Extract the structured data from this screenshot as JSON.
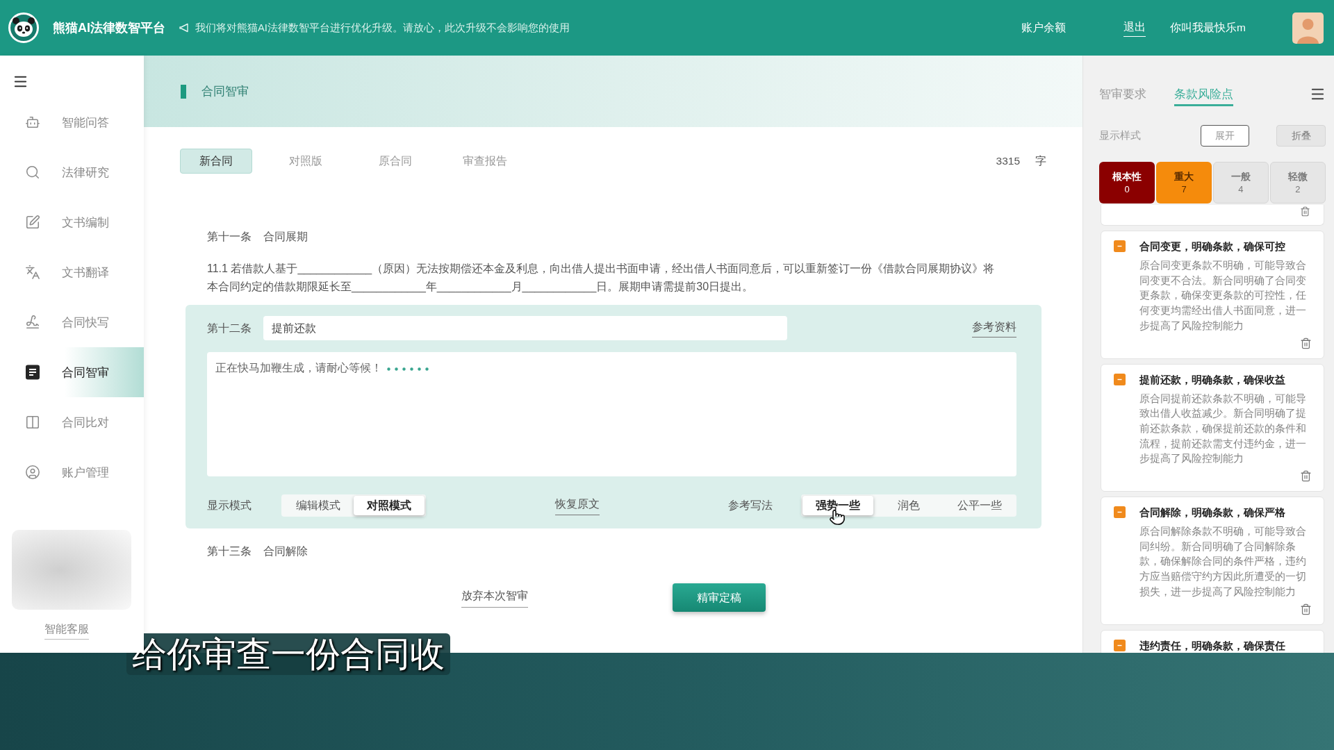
{
  "top_bar": {
    "title": "熊猫AI法律数智平台",
    "notice": "我们将对熊猫AI法律数智平台进行优化升级。请放心，此次升级不会影响您的使用",
    "balance_link": "账户余额",
    "logout_link": "退出",
    "user_name": "你叫我最快乐m"
  },
  "sidebar": {
    "items": [
      {
        "label": "智能问答",
        "selected": false
      },
      {
        "label": "法律研究",
        "selected": false
      },
      {
        "label": "文书编制",
        "selected": false
      },
      {
        "label": "文书翻译",
        "selected": false
      },
      {
        "label": "合同快写",
        "selected": false
      },
      {
        "label": "合同智审",
        "selected": true
      },
      {
        "label": "合同比对",
        "selected": false
      },
      {
        "label": "账户管理",
        "selected": false
      }
    ],
    "support_link": "智能客服"
  },
  "page_header": {
    "title": "合同智审"
  },
  "doc_tabs": [
    {
      "label": "新合同",
      "selected": true
    },
    {
      "label": "对照版",
      "selected": false
    },
    {
      "label": "原合同",
      "selected": false
    },
    {
      "label": "审查报告",
      "selected": false
    }
  ],
  "word_count": {
    "value": "3315",
    "unit": "字"
  },
  "document": [
    {
      "kind": "heading",
      "number": "第十一条",
      "title": "合同展期"
    },
    {
      "kind": "paragraph",
      "text": "11.1 若借款人基于____________（原因）无法按期偿还本金及利息，向出借人提出书面申请，经出借人书面同意后，可以重新签订一份《借款合同展期协议》将本合同约定的借款期限延长至____________年____________月____________日。展期申请需提前30日提出。"
    },
    {
      "kind": "editor",
      "number": "第十二条",
      "title_value": "提前还款",
      "reference_link": "参考资料",
      "status_text": "正在快马加鞭生成，请耐心等候！",
      "mode_label": "显示模式",
      "modes": [
        {
          "label": "编辑模式",
          "selected": false
        },
        {
          "label": "对照模式",
          "selected": true
        }
      ],
      "restore_link": "恢复原文",
      "style_label": "参考写法",
      "styles": [
        {
          "label": "强势一些",
          "selected": true
        },
        {
          "label": "润色",
          "selected": false
        },
        {
          "label": "公平一些",
          "selected": false
        }
      ]
    },
    {
      "kind": "heading",
      "number": "第十三条",
      "title": "合同解除"
    }
  ],
  "actions": {
    "abandon_link": "放弃本次智审",
    "finalize_button": "精审定稿"
  },
  "review_panel": {
    "tabs": [
      {
        "label": "智审要求",
        "selected": false
      },
      {
        "label": "条款风险点",
        "selected": true
      }
    ],
    "display_style_label": "显示样式",
    "expand_button": "展开",
    "collapse_button": "折叠",
    "severity_filters": [
      {
        "label": "根本性",
        "count": "0",
        "selected": true,
        "color": "#8b0000"
      },
      {
        "label": "重大",
        "count": "7",
        "selected": true,
        "color": "#f58b0c"
      },
      {
        "label": "一般",
        "count": "4",
        "selected": false
      },
      {
        "label": "轻微",
        "count": "2",
        "selected": false
      }
    ],
    "risk_items": [
      {
        "title": "合同变更，明确条款，确保可控",
        "text": "原合同变更条款不明确，可能导致合同变更不合法。新合同明确了合同变更条款，确保变更条款的可控性，任何变更均需经出借人书面同意，进一步提高了风险控制能力"
      },
      {
        "title": "提前还款，明确条款，确保收益",
        "text": "原合同提前还款条款不明确，可能导致出借人收益减少。新合同明确了提前还款条款，确保提前还款的条件和流程，提前还款需支付违约金，进一步提高了风险控制能力"
      },
      {
        "title": "合同解除，明确条款，确保严格",
        "text": "原合同解除条款不明确，可能导致合同纠纷。新合同明确了合同解除条款，确保解除合同的条件严格，违约方应当赔偿守约方因此所遭受的一切损失，进一步提高了风险控制能力"
      },
      {
        "title": "违约责任，明确条款，确保责任"
      }
    ]
  },
  "subtitle": "给你审查一份合同收"
}
